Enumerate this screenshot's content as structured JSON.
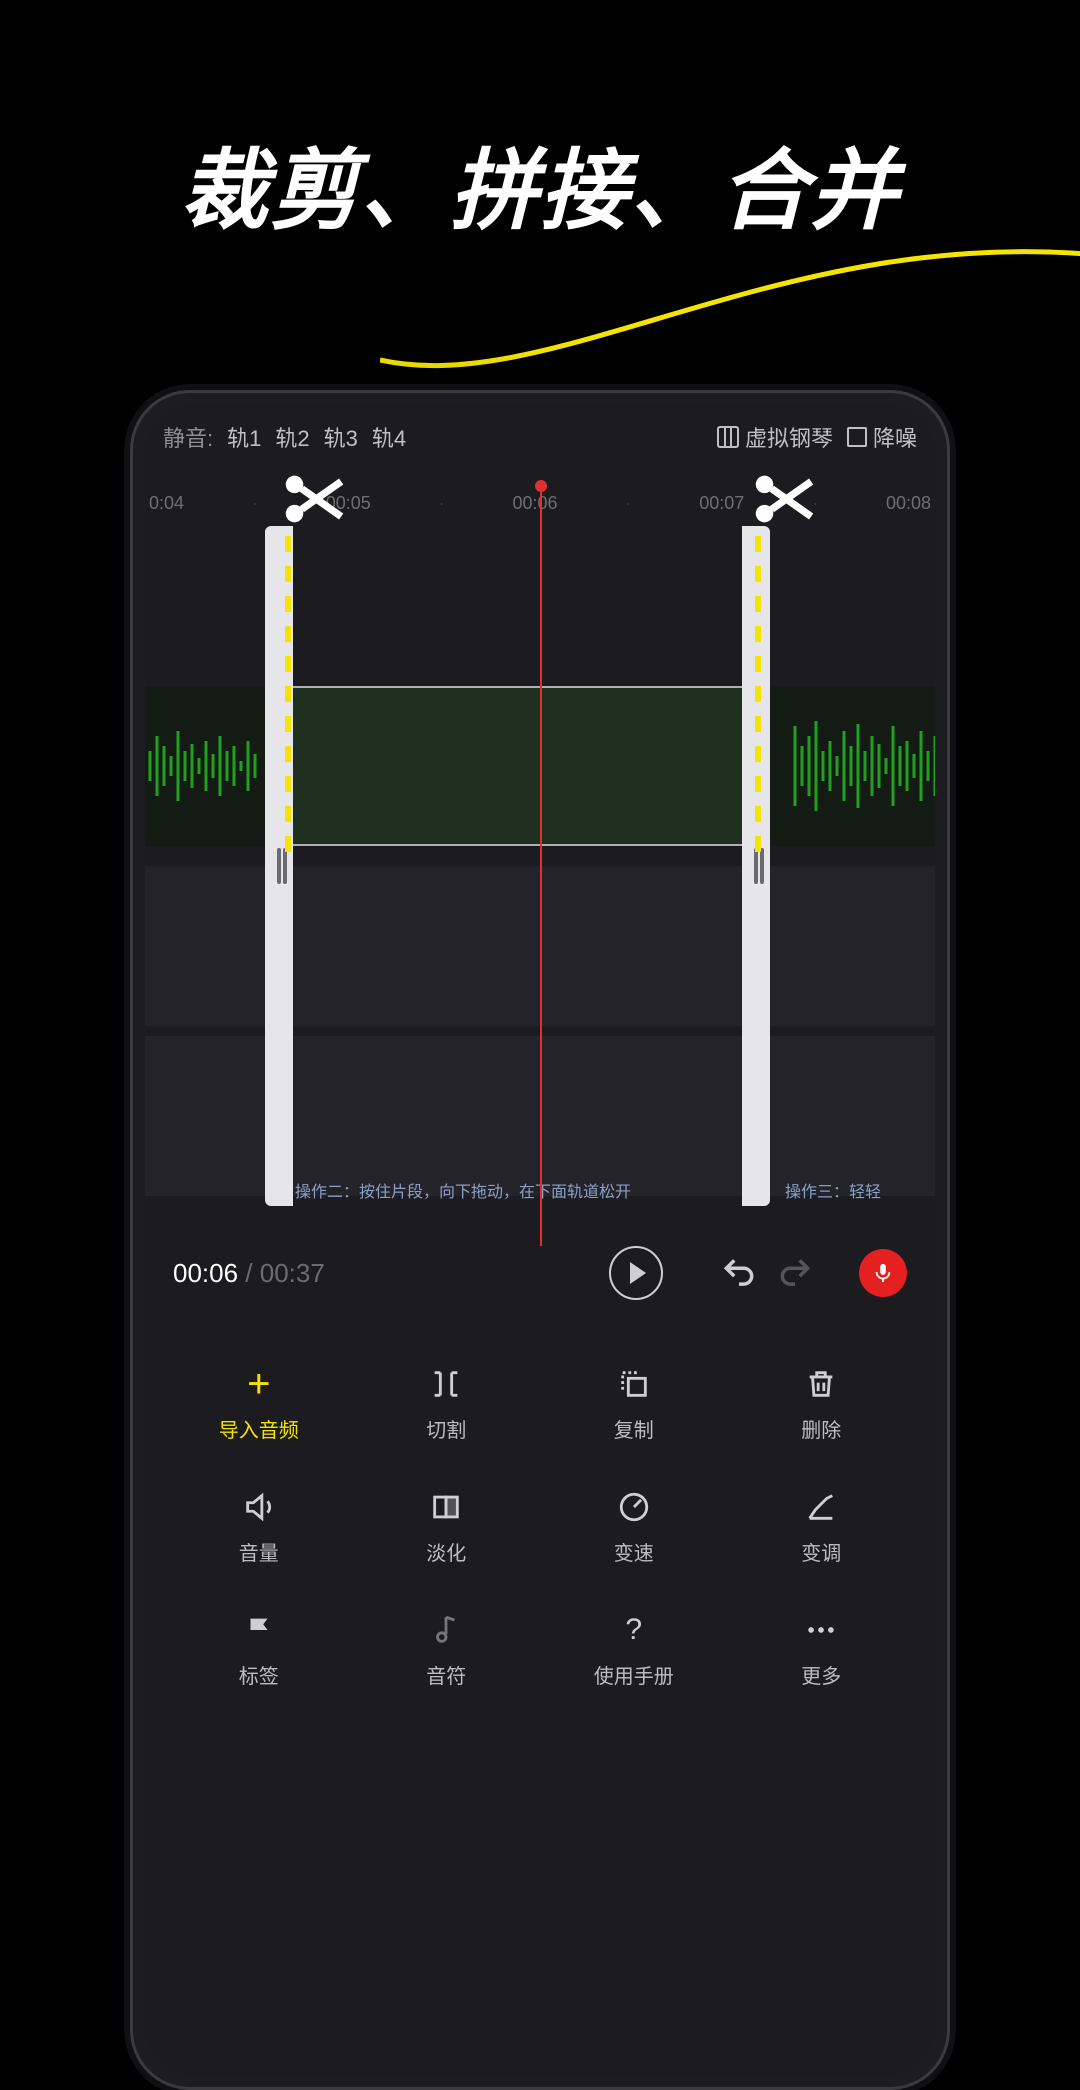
{
  "hero": {
    "title": "裁剪、拼接、合并"
  },
  "topbar": {
    "mute_label": "静音:",
    "tracks": [
      "轨1",
      "轨2",
      "轨3",
      "轨4"
    ],
    "piano_label": "虚拟钢琴",
    "noise_label": "降噪"
  },
  "ruler": [
    "0:04",
    "·",
    "00:05",
    "·",
    "00:06",
    "·",
    "00:07",
    "·",
    "00:08"
  ],
  "clip": {
    "hint_main": "操作二：按住片段，向下拖动，在下面轨道松开",
    "hint_right": "操作三：轻轻"
  },
  "transport": {
    "current": "00:06",
    "separator": " / ",
    "total": "00:37"
  },
  "tools": [
    {
      "label": "导入音频",
      "icon": "plus",
      "accent": true
    },
    {
      "label": "切割",
      "icon": "split"
    },
    {
      "label": "复制",
      "icon": "copy"
    },
    {
      "label": "删除",
      "icon": "trash"
    },
    {
      "label": "音量",
      "icon": "volume"
    },
    {
      "label": "淡化",
      "icon": "fade"
    },
    {
      "label": "变速",
      "icon": "speed"
    },
    {
      "label": "变调",
      "icon": "pitch"
    },
    {
      "label": "标签",
      "icon": "flag"
    },
    {
      "label": "音符",
      "icon": "note"
    },
    {
      "label": "使用手册",
      "icon": "help"
    },
    {
      "label": "更多",
      "icon": "more"
    }
  ]
}
